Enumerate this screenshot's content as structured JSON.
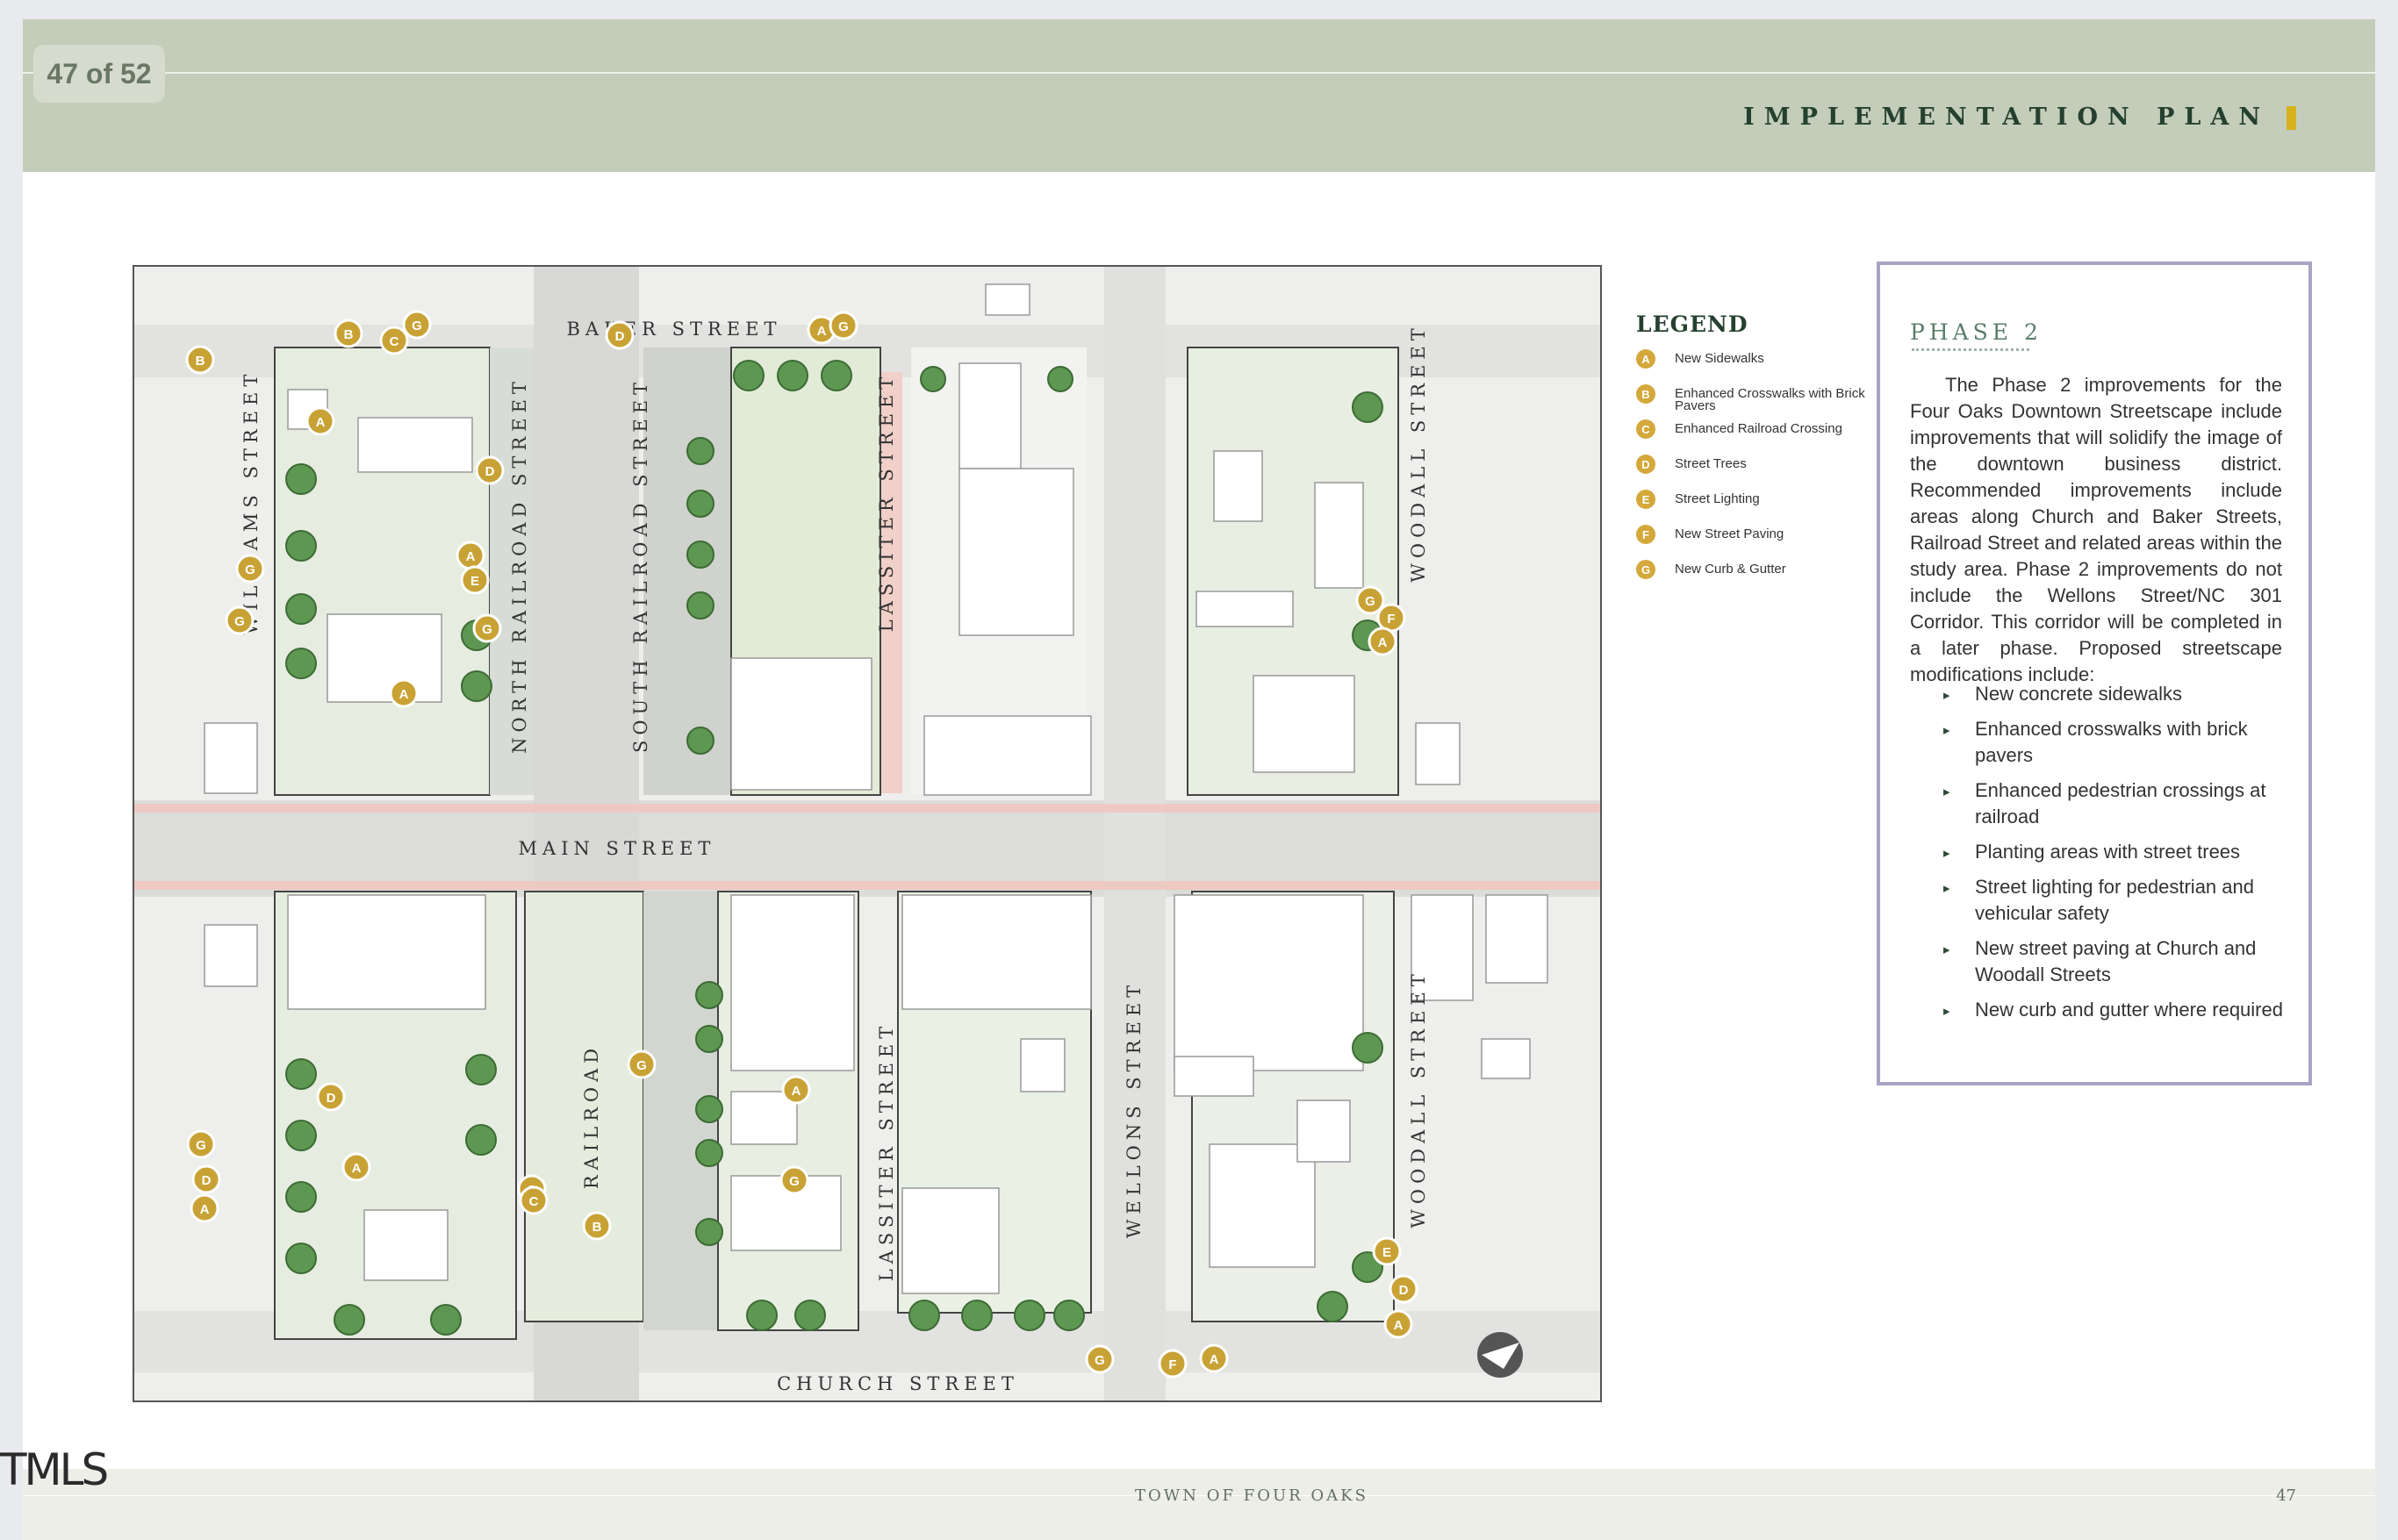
{
  "header": {
    "page_counter": "47 of 52",
    "section_title": "IMPLEMENTATION PLAN",
    "accent_color": "#d5b21e",
    "band_color": "#c3cdb9"
  },
  "map": {
    "streets": {
      "baker": "BAKER STREET",
      "main": "MAIN STREET",
      "church": "CHURCH STREET",
      "williams": "WILLIAMS STREET",
      "north_railroad": "NORTH RAILROAD STREET",
      "south_railroad": "SOUTH RAILROAD STREET",
      "lassiter_north": "LASSITER STREET",
      "lassiter_south": "LASSITER STREET",
      "woodall_north": "WOODALL STREET",
      "woodall_south": "WOODALL STREET",
      "railroad": "RAILROAD",
      "wellons": "WELLONS STREET"
    },
    "north_arrow_icon": "north-arrow-icon",
    "markers": [
      "B",
      "C",
      "G",
      "B",
      "A",
      "G",
      "G",
      "A",
      "D",
      "A",
      "E",
      "G",
      "D",
      "A",
      "G",
      "G",
      "F",
      "A",
      "D",
      "A",
      "G",
      "D",
      "A",
      "G",
      "C",
      "B",
      "G",
      "A",
      "G",
      "E",
      "D",
      "A",
      "G",
      "F",
      "A"
    ]
  },
  "legend": {
    "title": "LEGEND",
    "items": [
      {
        "key": "A",
        "label": "New Sidewalks"
      },
      {
        "key": "B",
        "label": "Enhanced Crosswalks with Brick Pavers"
      },
      {
        "key": "C",
        "label": "Enhanced Railroad Crossing"
      },
      {
        "key": "D",
        "label": "Street Trees"
      },
      {
        "key": "E",
        "label": "Street Lighting"
      },
      {
        "key": "F",
        "label": "New Street Paving"
      },
      {
        "key": "G",
        "label": "New Curb & Gutter"
      }
    ]
  },
  "phase": {
    "title": "PHASE 2",
    "body": "The Phase 2 improvements for the Four Oaks Downtown Streetscape include improvements that will solidify the image of the downtown business district. Recommended improvements include areas along Church and Baker Streets, Railroad Street and related areas within the study area. Phase 2 improvements do not include the Wellons Street/NC 301 Corridor. This corridor will be completed in a later phase. Proposed streetscape modifications include:",
    "bullets": [
      "New concrete sidewalks",
      "Enhanced crosswalks with brick pavers",
      "Enhanced pedestrian crossings at railroad",
      "Planting areas with street trees",
      "Street lighting for pedestrian and vehicular safety",
      "New street paving at Church and Woodall Streets",
      "New curb and gutter where required"
    ]
  },
  "footer": {
    "town": "TOWN OF FOUR OAKS",
    "page_number": "47",
    "corner_mark": "TMLS"
  }
}
